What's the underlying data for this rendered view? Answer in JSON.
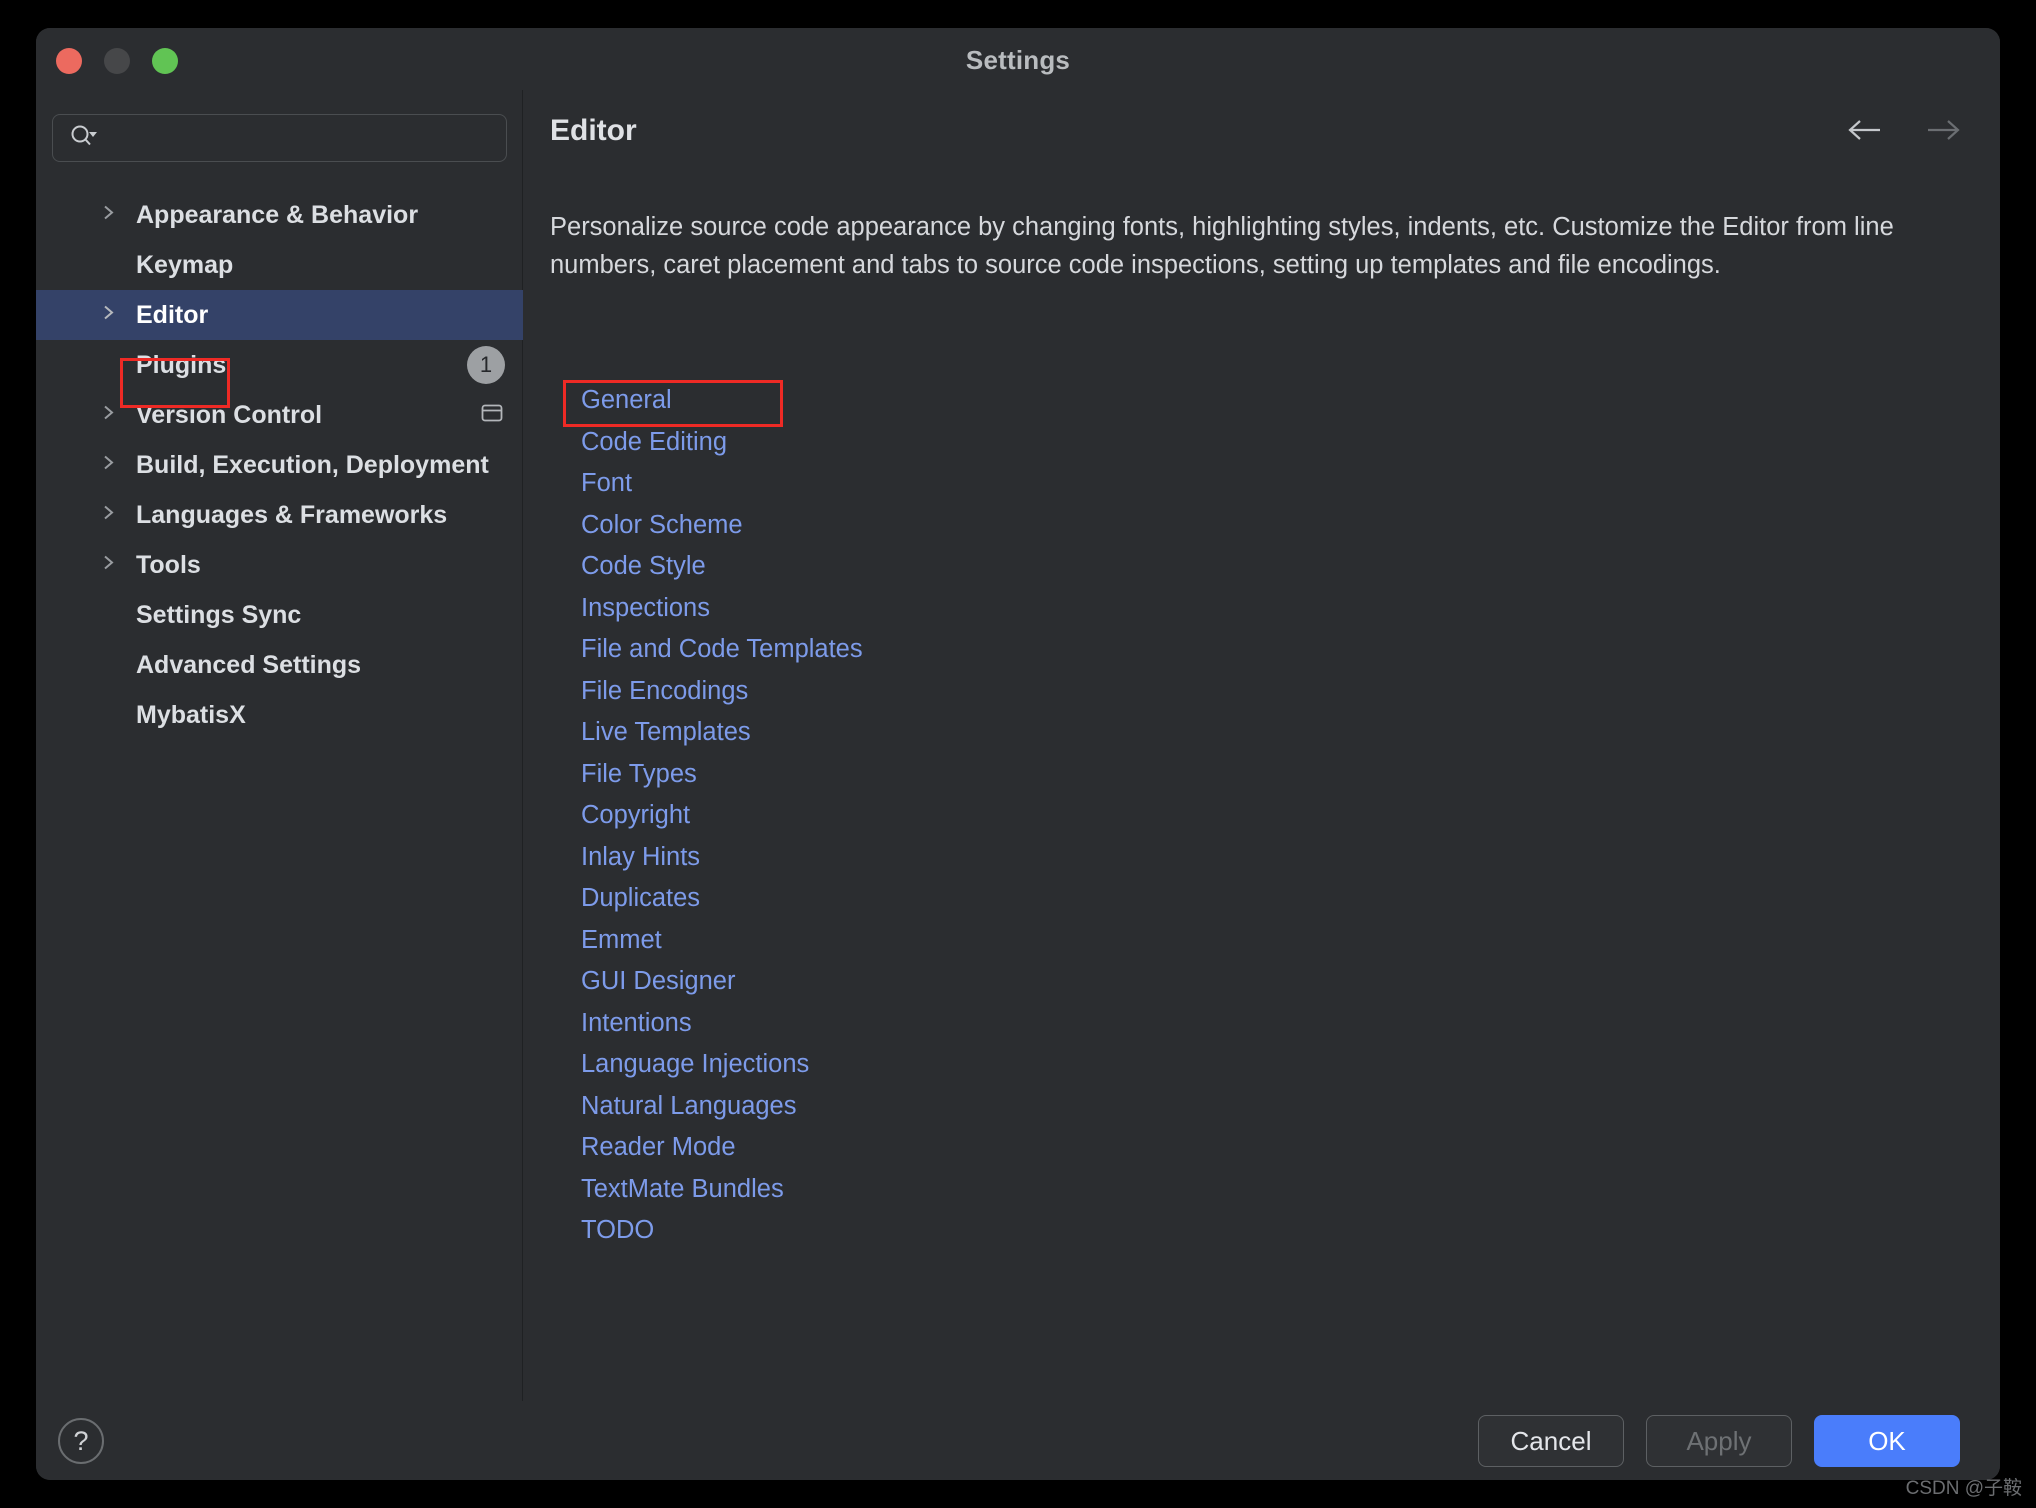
{
  "window": {
    "title": "Settings",
    "traffic_lights": [
      {
        "name": "close-button",
        "color": "#ec6a5f"
      },
      {
        "name": "minimize-button",
        "color": "#464749"
      },
      {
        "name": "zoom-button",
        "color": "#61c454"
      }
    ]
  },
  "search": {
    "value": "",
    "placeholder": "",
    "icon": "search-icon-with-dropdown"
  },
  "sidebar": {
    "items": [
      {
        "label": "Appearance & Behavior",
        "expandable": true,
        "selected": false,
        "badge": null,
        "icon": null
      },
      {
        "label": "Keymap",
        "expandable": false,
        "selected": false,
        "badge": null,
        "icon": null
      },
      {
        "label": "Editor",
        "expandable": true,
        "selected": true,
        "badge": null,
        "icon": null
      },
      {
        "label": "Plugins",
        "expandable": false,
        "selected": false,
        "badge": "1",
        "icon": null
      },
      {
        "label": "Version Control",
        "expandable": true,
        "selected": false,
        "badge": null,
        "icon": "panel-icon"
      },
      {
        "label": "Build, Execution, Deployment",
        "expandable": true,
        "selected": false,
        "badge": null,
        "icon": null
      },
      {
        "label": "Languages & Frameworks",
        "expandable": true,
        "selected": false,
        "badge": null,
        "icon": null
      },
      {
        "label": "Tools",
        "expandable": true,
        "selected": false,
        "badge": null,
        "icon": null
      },
      {
        "label": "Settings Sync",
        "expandable": false,
        "selected": false,
        "badge": null,
        "icon": null
      },
      {
        "label": "Advanced Settings",
        "expandable": false,
        "selected": false,
        "badge": null,
        "icon": null
      },
      {
        "label": "MybatisX",
        "expandable": false,
        "selected": false,
        "badge": null,
        "icon": null
      }
    ]
  },
  "content": {
    "title": "Editor",
    "description": "Personalize source code appearance by changing fonts, highlighting styles, indents, etc. Customize the Editor from line numbers, caret placement and tabs to source code inspections, setting up templates and file encodings.",
    "back_arrow": "arrow-left-icon",
    "forward_arrow": "arrow-right-icon",
    "links": [
      {
        "label": "General"
      },
      {
        "label": "Code Editing"
      },
      {
        "label": "Font"
      },
      {
        "label": "Color Scheme"
      },
      {
        "label": "Code Style"
      },
      {
        "label": "Inspections"
      },
      {
        "label": "File and Code Templates"
      },
      {
        "label": "File Encodings"
      },
      {
        "label": "Live Templates"
      },
      {
        "label": "File Types"
      },
      {
        "label": "Copyright"
      },
      {
        "label": "Inlay Hints"
      },
      {
        "label": "Duplicates"
      },
      {
        "label": "Emmet"
      },
      {
        "label": "GUI Designer"
      },
      {
        "label": "Intentions"
      },
      {
        "label": "Language Injections"
      },
      {
        "label": "Natural Languages"
      },
      {
        "label": "Reader Mode"
      },
      {
        "label": "TextMate Bundles"
      },
      {
        "label": "TODO"
      }
    ]
  },
  "footer": {
    "help_label": "?",
    "cancel_label": "Cancel",
    "apply_label": "Apply",
    "ok_label": "OK"
  },
  "annotations": {
    "highlight_color": "#ee2a25",
    "sidebar_target": "Editor",
    "link_target": "File Encodings"
  },
  "watermark": {
    "text": "CSDN @子鞍"
  },
  "colors": {
    "window_bg": "#2b2d30",
    "selection_blue": "#344268",
    "link_blue": "#7d9bea",
    "primary_button": "#4a7dfb",
    "annotation_red": "#ee2a25"
  }
}
